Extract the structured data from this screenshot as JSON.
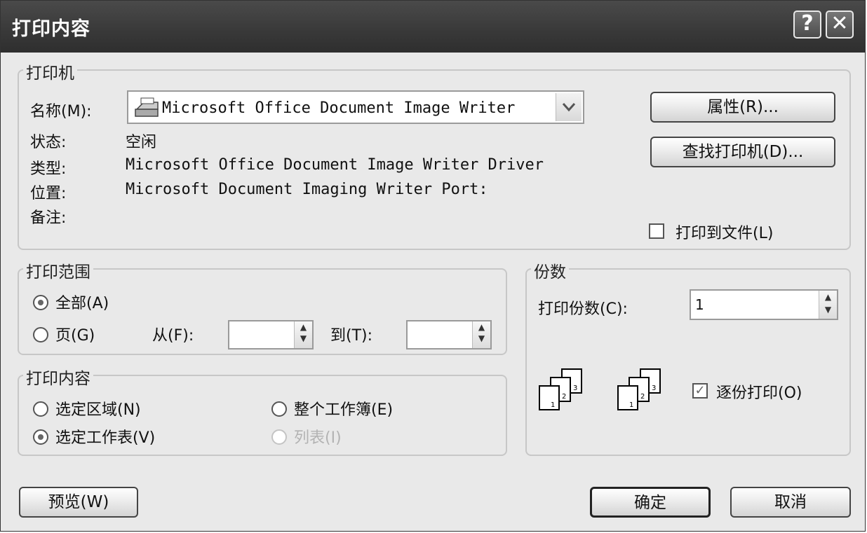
{
  "window": {
    "title": "打印内容",
    "help_label": "?",
    "close_label": "✕"
  },
  "printer": {
    "group_label": "打印机",
    "name_label": "名称(M):",
    "name_value": "Microsoft Office Document Image Writer",
    "status_label": "状态:",
    "status_value": "空闲",
    "type_label": "类型:",
    "type_value": "Microsoft Office Document Image Writer Driver",
    "location_label": "位置:",
    "location_value": "Microsoft Document Imaging Writer Port:",
    "comment_label": "备注:",
    "properties_button": "属性(R)...",
    "find_printer_button": "查找打印机(D)...",
    "print_to_file_label": "打印到文件(L)",
    "print_to_file_checked": false
  },
  "range": {
    "group_label": "打印范围",
    "all_label": "全部(A)",
    "pages_label": "页(G)",
    "from_label": "从(F):",
    "to_label": "到(T):",
    "selected": "all"
  },
  "content": {
    "group_label": "打印内容",
    "selection_label": "选定区域(N)",
    "workbook_label": "整个工作簿(E)",
    "sheet_label": "选定工作表(V)",
    "list_label": "列表(I)",
    "selected": "sheet"
  },
  "copies": {
    "group_label": "份数",
    "count_label": "打印份数(C):",
    "count_value": "1",
    "collate_label": "逐份打印(O)",
    "collate_checked": true
  },
  "footer": {
    "preview_button": "预览(W)",
    "ok_button": "确定",
    "cancel_button": "取消"
  }
}
